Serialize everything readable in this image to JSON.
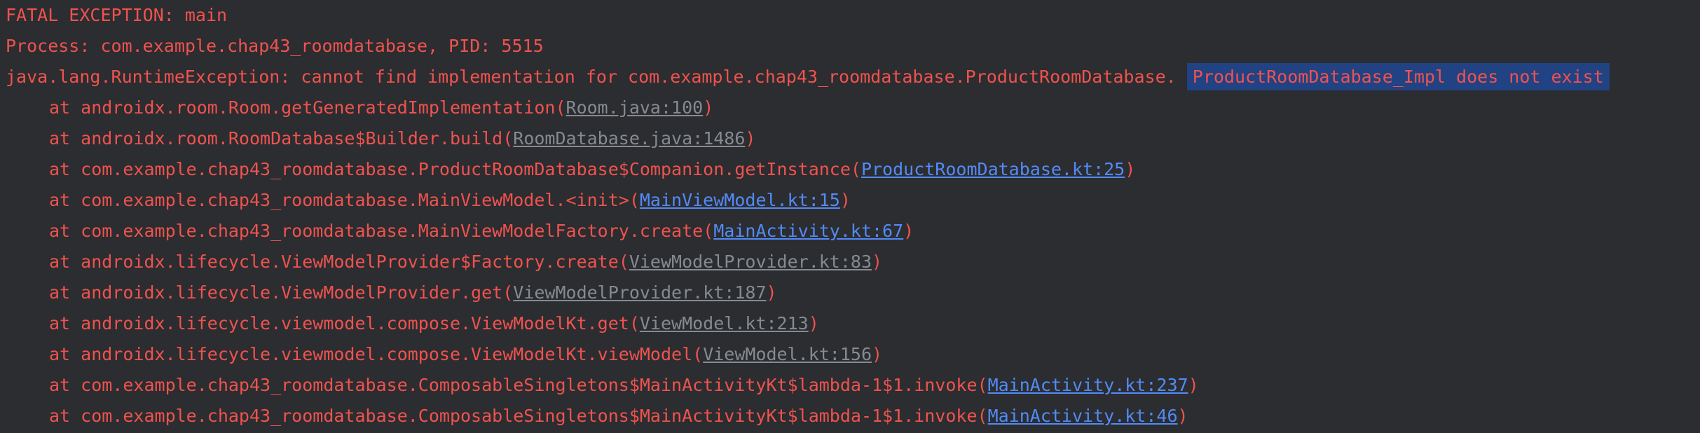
{
  "header": {
    "fatal": "FATAL EXCEPTION: main",
    "process": "Process: com.example.chap43_roomdatabase, PID: 5515",
    "exception_prefix": "java.lang.RuntimeException: cannot find implementation for com.example.chap43_roomdatabase.ProductRoomDatabase.",
    "exception_highlight": "ProductRoomDatabase_Impl does not exist"
  },
  "frames": [
    {
      "method": "at androidx.room.Room.getGeneratedImplementation(",
      "link": "Room.java:100",
      "link_type": "library",
      "suffix": ")"
    },
    {
      "method": "at androidx.room.RoomDatabase$Builder.build(",
      "link": "RoomDatabase.java:1486",
      "link_type": "library",
      "suffix": ")"
    },
    {
      "method": "at com.example.chap43_roomdatabase.ProductRoomDatabase$Companion.getInstance(",
      "link": "ProductRoomDatabase.kt:25",
      "link_type": "project",
      "suffix": ")"
    },
    {
      "method": "at com.example.chap43_roomdatabase.MainViewModel.<init>(",
      "link": "MainViewModel.kt:15",
      "link_type": "project",
      "suffix": ")"
    },
    {
      "method": "at com.example.chap43_roomdatabase.MainViewModelFactory.create(",
      "link": "MainActivity.kt:67",
      "link_type": "project",
      "suffix": ")"
    },
    {
      "method": "at androidx.lifecycle.ViewModelProvider$Factory.create(",
      "link": "ViewModelProvider.kt:83",
      "link_type": "library",
      "suffix": ")"
    },
    {
      "method": "at androidx.lifecycle.ViewModelProvider.get(",
      "link": "ViewModelProvider.kt:187",
      "link_type": "library",
      "suffix": ")"
    },
    {
      "method": "at androidx.lifecycle.viewmodel.compose.ViewModelKt.get(",
      "link": "ViewModel.kt:213",
      "link_type": "library",
      "suffix": ")"
    },
    {
      "method": "at androidx.lifecycle.viewmodel.compose.ViewModelKt.viewModel(",
      "link": "ViewModel.kt:156",
      "link_type": "library",
      "suffix": ")"
    },
    {
      "method": "at com.example.chap43_roomdatabase.ComposableSingletons$MainActivityKt$lambda-1$1.invoke(",
      "link": "MainActivity.kt:237",
      "link_type": "project",
      "suffix": ")"
    },
    {
      "method": "at com.example.chap43_roomdatabase.ComposableSingletons$MainActivityKt$lambda-1$1.invoke(",
      "link": "MainActivity.kt:46",
      "link_type": "project",
      "suffix": ")"
    }
  ],
  "colors": {
    "background": "#2b2d30",
    "error_text": "#f0524f",
    "project_link": "#548af7",
    "library_link": "#868a91",
    "selection": "#214283"
  }
}
